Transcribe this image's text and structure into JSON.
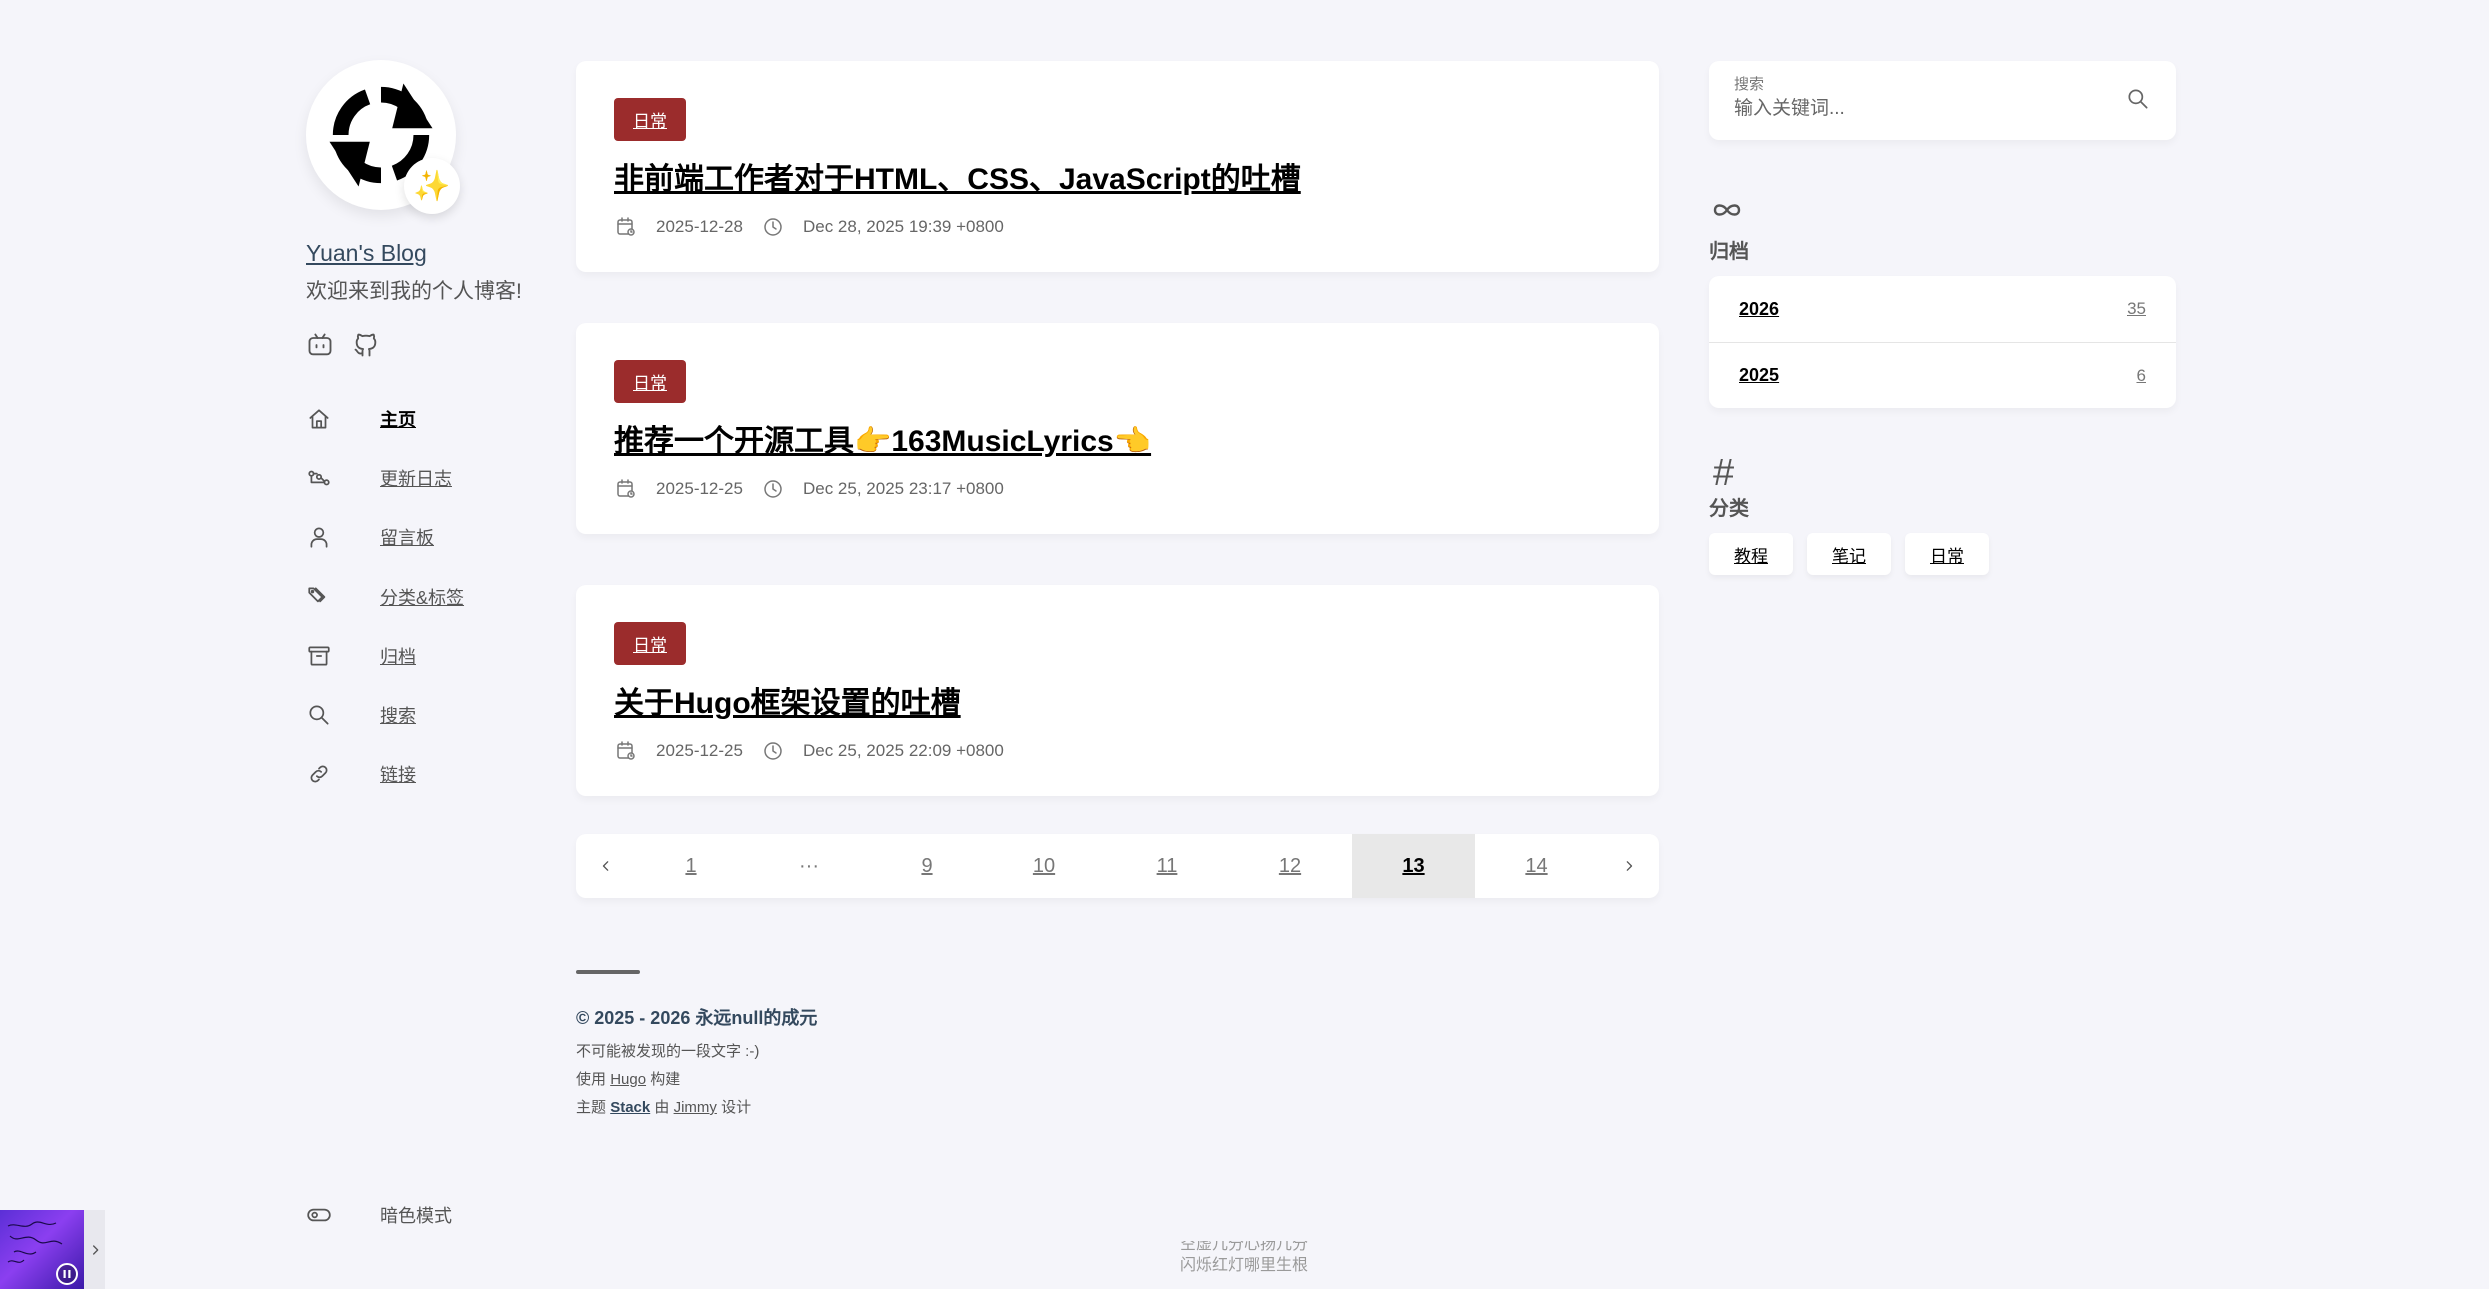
{
  "site": {
    "name": "Yuan's Blog",
    "description": "欢迎来到我的个人博客!",
    "avatar_badge": "✨"
  },
  "social": [
    {
      "icon": "bilibili-icon"
    },
    {
      "icon": "github-icon"
    }
  ],
  "menu": [
    {
      "label": "主页",
      "icon": "home-icon",
      "active": true
    },
    {
      "label": "更新日志",
      "icon": "changelog-icon"
    },
    {
      "label": "留言板",
      "icon": "user-icon"
    },
    {
      "label": "分类&标签",
      "icon": "tags-icon"
    },
    {
      "label": "归档",
      "icon": "archive-icon"
    },
    {
      "label": "搜索",
      "icon": "search-icon"
    },
    {
      "label": "链接",
      "icon": "link-icon"
    }
  ],
  "dark_mode": {
    "label": "暗色模式"
  },
  "articles": [
    {
      "category": "日常",
      "title": "非前端工作者对于HTML、CSS、JavaScript的吐槽",
      "date": "2025-12-28",
      "time": "Dec 28, 2025 19:39 +0800"
    },
    {
      "category": "日常",
      "title": "推荐一个开源工具👉163MusicLyrics👈",
      "date": "2025-12-25",
      "time": "Dec 25, 2025 23:17 +0800"
    },
    {
      "category": "日常",
      "title": "关于Hugo框架设置的吐槽",
      "date": "2025-12-25",
      "time": "Dec 25, 2025 22:09 +0800"
    }
  ],
  "pagination": {
    "pages": [
      "1",
      "···",
      "9",
      "10",
      "11",
      "12",
      "13",
      "14"
    ],
    "current": "13"
  },
  "footer": {
    "copyright": "© 2025 - 2026 永远null的成元",
    "tagline": "不可能被发现的一段文字 :-)",
    "built_prefix": "使用",
    "built_link": "Hugo",
    "built_suffix": "构建",
    "theme_prefix": "主题",
    "theme_link": "Stack",
    "theme_by": "由",
    "theme_author": "Jimmy",
    "theme_suffix": "设计"
  },
  "search": {
    "label": "搜索",
    "placeholder": "输入关键词..."
  },
  "archives": {
    "title": "归档",
    "years": [
      {
        "year": "2026",
        "count": "35"
      },
      {
        "year": "2025",
        "count": "6"
      }
    ]
  },
  "categories": {
    "title": "分类",
    "items": [
      "教程",
      "笔记",
      "日常"
    ]
  },
  "lyrics": {
    "line1": "空虚几分心扬几分",
    "line2": "闪烁红灯哪里生根"
  },
  "colors": {
    "background": "#f5f5fa",
    "category_badge": "#9b2c2c",
    "site_name": "#34495e"
  }
}
